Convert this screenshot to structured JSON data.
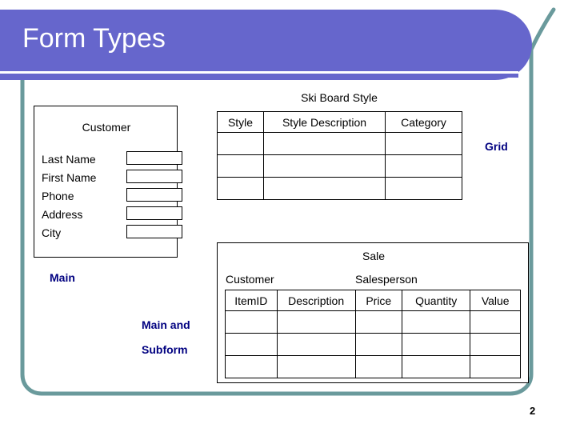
{
  "slide": {
    "title": "Form Types",
    "page_number": "2",
    "colors": {
      "banner_purple": "#6666cc",
      "frame_teal": "#6a9a9c",
      "annotation_navy": "#000080",
      "outline_black": "#000000"
    }
  },
  "customer_form": {
    "title": "Customer",
    "annotation": "Main",
    "fields": [
      {
        "label": "Last Name",
        "value": ""
      },
      {
        "label": "First Name",
        "value": ""
      },
      {
        "label": "Phone",
        "value": ""
      },
      {
        "label": "Address",
        "value": ""
      },
      {
        "label": "City",
        "value": ""
      }
    ]
  },
  "ski_board_grid": {
    "caption": "Ski Board Style",
    "annotation": "Grid",
    "columns": [
      "Style",
      "Style Description",
      "Category"
    ],
    "rows": [
      [
        "",
        "",
        ""
      ],
      [
        "",
        "",
        ""
      ],
      [
        "",
        "",
        ""
      ]
    ]
  },
  "sale_form": {
    "title": "Sale",
    "customer_label": "Customer",
    "salesperson_label": "Salesperson",
    "annotation_line1": "Main and",
    "annotation_line2": "Subform",
    "subform": {
      "columns": [
        "ItemID",
        "Description",
        "Price",
        "Quantity",
        "Value"
      ],
      "rows": [
        [
          "",
          "",
          "",
          "",
          ""
        ],
        [
          "",
          "",
          "",
          "",
          ""
        ],
        [
          "",
          "",
          "",
          "",
          ""
        ]
      ]
    }
  }
}
